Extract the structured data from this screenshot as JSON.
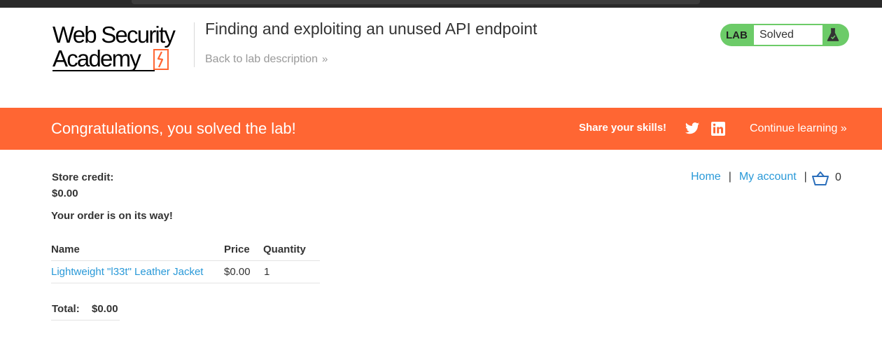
{
  "brand": {
    "line1": "Web Security",
    "line2": "Academy",
    "accent_color": "#ff6633"
  },
  "header": {
    "lab_title": "Finding and exploiting an unused API endpoint",
    "back_link": "Back to lab description",
    "back_icon": "double-chevron-right-icon"
  },
  "lab_status": {
    "badge": "LAB",
    "status": "Solved",
    "icon": "flask-icon",
    "color": "#6ccb68"
  },
  "banner": {
    "message": "Congratulations, you solved the lab!",
    "share_label": "Share your skills!",
    "share_icons": [
      "twitter-icon",
      "linkedin-icon"
    ],
    "continue_label": "Continue learning",
    "color": "#ff6633"
  },
  "nav": {
    "home": "Home",
    "separator": "|",
    "my_account": "My account",
    "cart_icon": "cart-icon",
    "cart_count": "0"
  },
  "account": {
    "credit_label": "Store credit:",
    "credit_value": "$0.00",
    "order_message": "Your order is on its way!"
  },
  "order": {
    "columns": [
      "Name",
      "Price",
      "Quantity"
    ],
    "rows": [
      {
        "name": "Lightweight \"l33t\" Leather Jacket",
        "price": "$0.00",
        "quantity": "1"
      }
    ],
    "total_label": "Total:",
    "total_value": "$0.00"
  }
}
